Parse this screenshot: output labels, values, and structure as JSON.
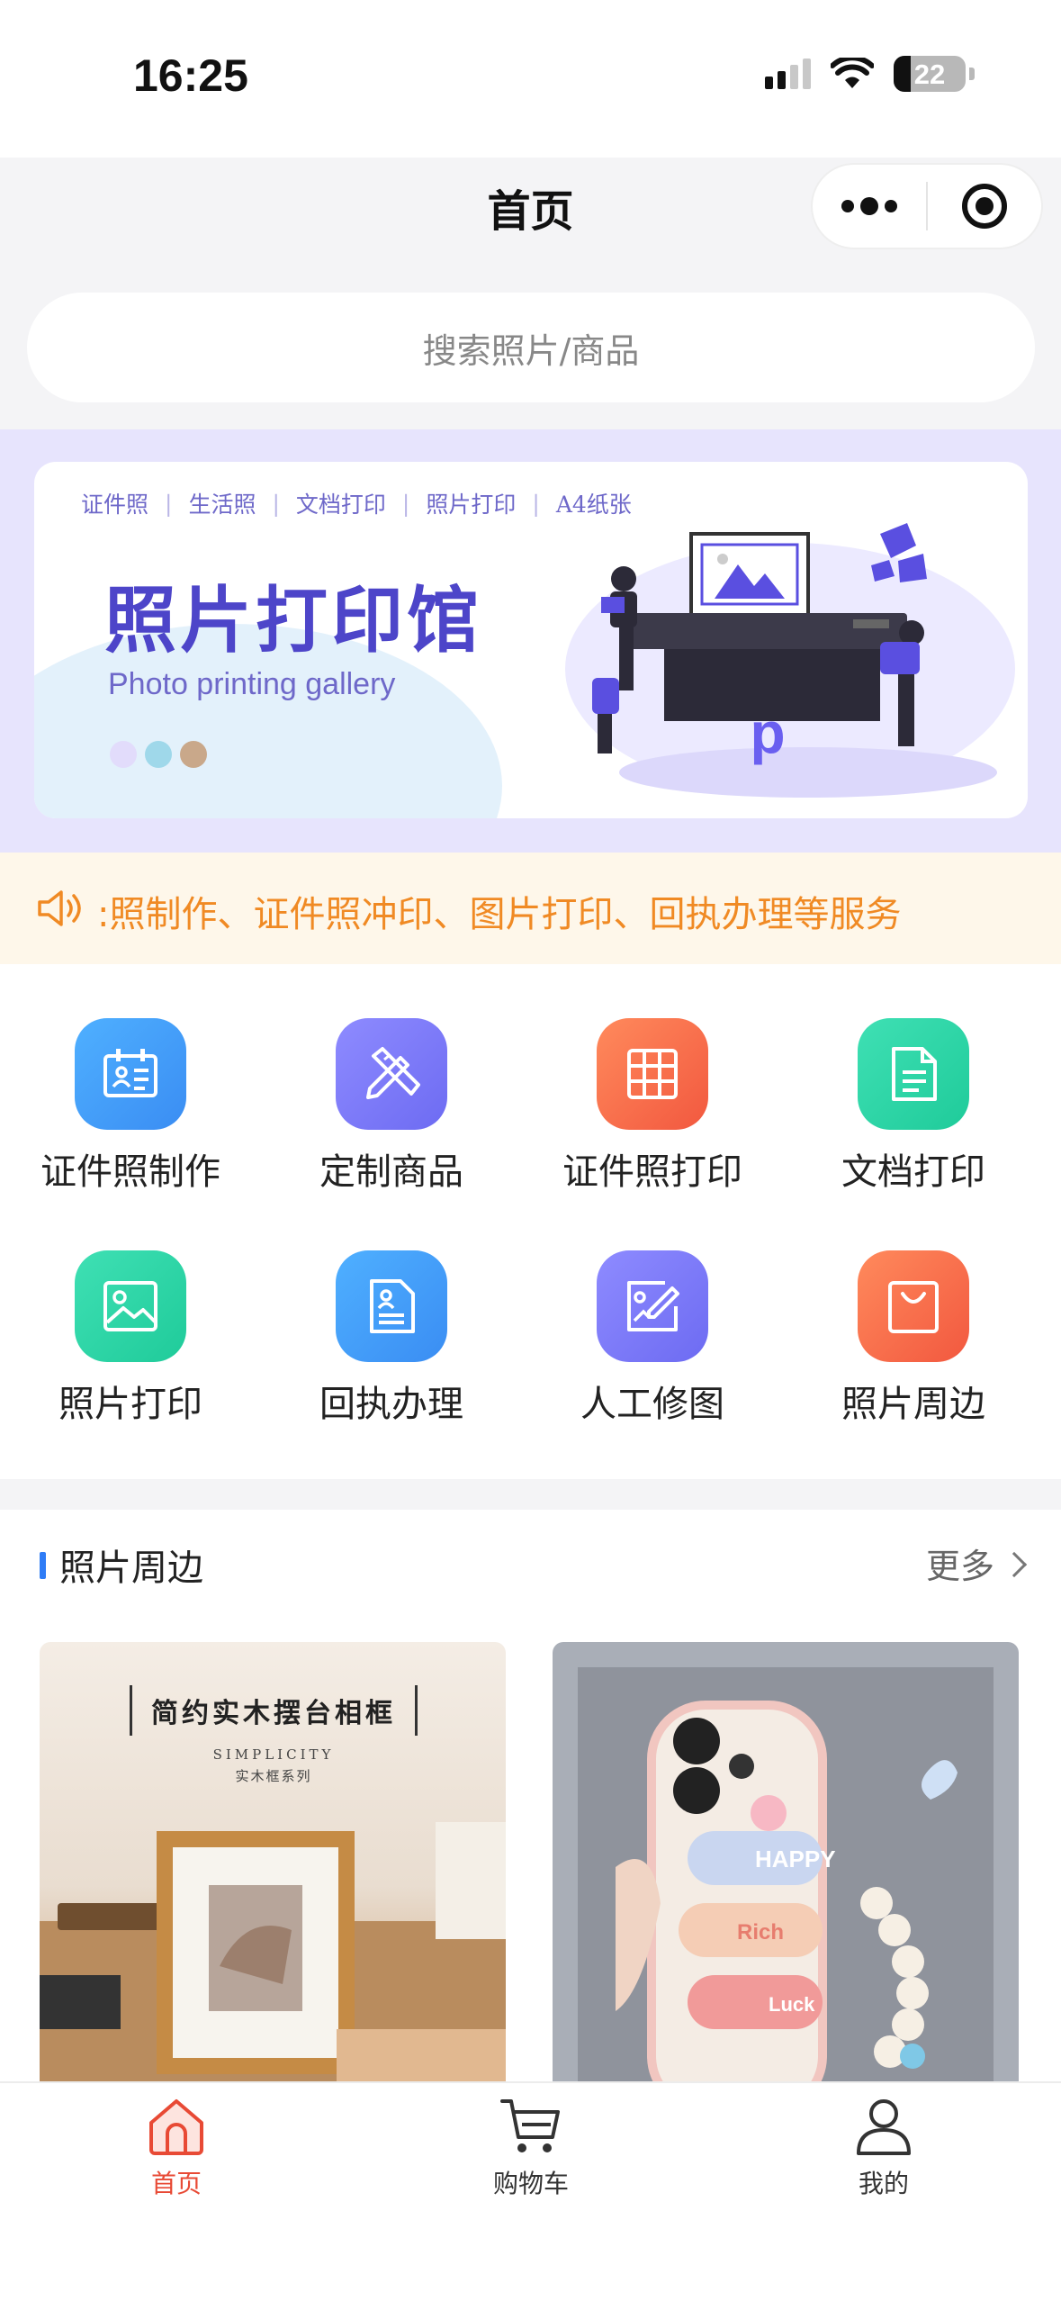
{
  "status_bar": {
    "time": "16:25",
    "battery": "22",
    "icons": [
      "signal-icon",
      "wifi-icon",
      "battery-icon"
    ]
  },
  "nav": {
    "title": "首页",
    "capsule_icons": [
      "more-dots-icon",
      "close-target-icon"
    ]
  },
  "search": {
    "placeholder": "搜索照片/商品"
  },
  "banner": {
    "tags": [
      "证件照",
      "生活照",
      "文档打印",
      "照片打印",
      "A4纸张"
    ],
    "title": "照片打印馆",
    "subtitle": "Photo printing gallery",
    "illustration_letter": "p",
    "dot_colors": [
      "#e2dcfb",
      "#9fd8ea",
      "#c9a88a"
    ]
  },
  "notice": {
    "icon": "speaker-icon",
    "text": ":照制作、证件照冲印、图片打印、回执办理等服务"
  },
  "services": [
    {
      "label": "证件照制作",
      "icon": "id-card-icon",
      "color_from": "#4fb0ff",
      "color_to": "#3a8df3"
    },
    {
      "label": "定制商品",
      "icon": "pencil-ruler-icon",
      "color_from": "#8e8bff",
      "color_to": "#6d6bf2"
    },
    {
      "label": "证件照打印",
      "icon": "grid-icon",
      "color_from": "#ff8a5c",
      "color_to": "#f2583f"
    },
    {
      "label": "文档打印",
      "icon": "document-icon",
      "color_from": "#3fe0b4",
      "color_to": "#1fcb9a"
    },
    {
      "label": "照片打印",
      "icon": "image-icon",
      "color_from": "#3fe0b4",
      "color_to": "#1fcb9a"
    },
    {
      "label": "回执办理",
      "icon": "receipt-icon",
      "color_from": "#4fb0ff",
      "color_to": "#3a8df3"
    },
    {
      "label": "人工修图",
      "icon": "photo-edit-icon",
      "color_from": "#8e8bff",
      "color_to": "#6d6bf2"
    },
    {
      "label": "照片周边",
      "icon": "shopping-bag-icon",
      "color_from": "#ff8a5c",
      "color_to": "#f2583f"
    }
  ],
  "section": {
    "title": "照片周边",
    "more_label": "更多",
    "products": [
      {
        "title": "简约实木摆台相框",
        "subtitle": "SIMPLICITY",
        "subtitle2": "实木框系列"
      },
      {
        "case_texts": [
          "HAPPY",
          "Rich",
          "Luck"
        ]
      }
    ]
  },
  "tabbar": {
    "items": [
      {
        "label": "首页",
        "icon": "home-icon",
        "active": true
      },
      {
        "label": "购物车",
        "icon": "cart-icon",
        "active": false
      },
      {
        "label": "我的",
        "icon": "user-icon",
        "active": false
      }
    ],
    "active_color": "#e84a35"
  }
}
